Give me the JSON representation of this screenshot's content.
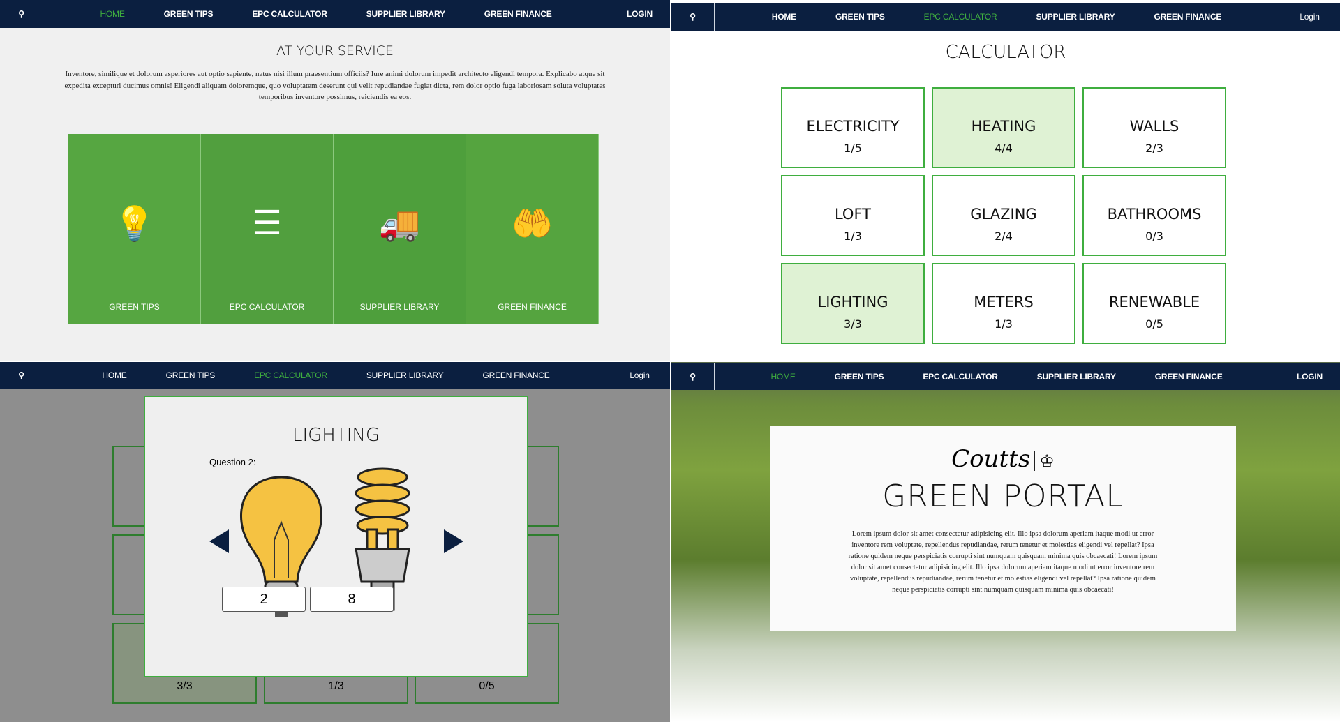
{
  "nav": {
    "items": [
      "HOME",
      "GREEN TIPS",
      "EPC CALCULATOR",
      "SUPPLIER LIBRARY",
      "GREEN FINANCE"
    ],
    "login_upper": "LOGIN",
    "login": "Login"
  },
  "home": {
    "title": "AT YOUR SERVICE",
    "paragraph": "Inventore, similique et dolorum asperiores aut optio sapiente, natus nisi illum praesentium officiis? Iure animi dolorum impedit architecto eligendi tempora. Explicabo atque sit expedita excepturi ducimus omnis! Eligendi aliquam doloremque, quo voluptatem deserunt qui velit repudiandae fugiat dicta, rem dolor optio fuga laboriosam soluta voluptates temporibus inventore possimus, reiciendis ea eos.",
    "tiles": [
      {
        "label": "GREEN TIPS",
        "icon": "lightbulb-icon"
      },
      {
        "label": "EPC CALCULATOR",
        "icon": "energy-rating-icon"
      },
      {
        "label": "SUPPLIER LIBRARY",
        "icon": "truck-icon"
      },
      {
        "label": "GREEN FINANCE",
        "icon": "hand-leaf-icon"
      }
    ]
  },
  "calculator": {
    "title": "CALCULATOR",
    "cells": [
      {
        "name": "ELECTRICITY",
        "count": "1/5",
        "done": false
      },
      {
        "name": "HEATING",
        "count": "4/4",
        "done": true
      },
      {
        "name": "WALLS",
        "count": "2/3",
        "done": false
      },
      {
        "name": "LOFT",
        "count": "1/3",
        "done": false
      },
      {
        "name": "GLAZING",
        "count": "2/4",
        "done": false
      },
      {
        "name": "BATHROOMS",
        "count": "0/3",
        "done": false
      },
      {
        "name": "LIGHTING",
        "count": "3/3",
        "done": true
      },
      {
        "name": "METERS",
        "count": "1/3",
        "done": false
      },
      {
        "name": "RENEWABLE",
        "count": "0/5",
        "done": false
      }
    ]
  },
  "modal": {
    "title": "LIGHTING",
    "question": "Question 2:",
    "values": [
      "2",
      "8"
    ],
    "behind_counts": [
      "3/3",
      "1/3",
      "0/5"
    ]
  },
  "portal": {
    "brand": "Coutts",
    "title": "GREEN PORTAL",
    "paragraph": "Lorem ipsum dolor sit amet consectetur adipisicing elit. Illo ipsa dolorum aperiam itaque modi ut error inventore rem voluptate, repellendus repudiandae, rerum tenetur et molestias eligendi vel repellat? Ipsa ratione quidem neque perspiciatis corrupti sint numquam quisquam minima quis obcaecati! Lorem ipsum dolor sit amet consectetur adipisicing elit. Illo ipsa dolorum aperiam itaque modi ut error inventore rem voluptate, repellendus repudiandae, rerum tenetur et molestias eligendi vel repellat? Ipsa ratione quidem neque perspiciatis corrupti sint numquam quisquam minima quis obcaecati!"
  },
  "colors": {
    "nav": "#0b1f40",
    "accent": "#3fae3f",
    "done": "#dff2d4"
  }
}
